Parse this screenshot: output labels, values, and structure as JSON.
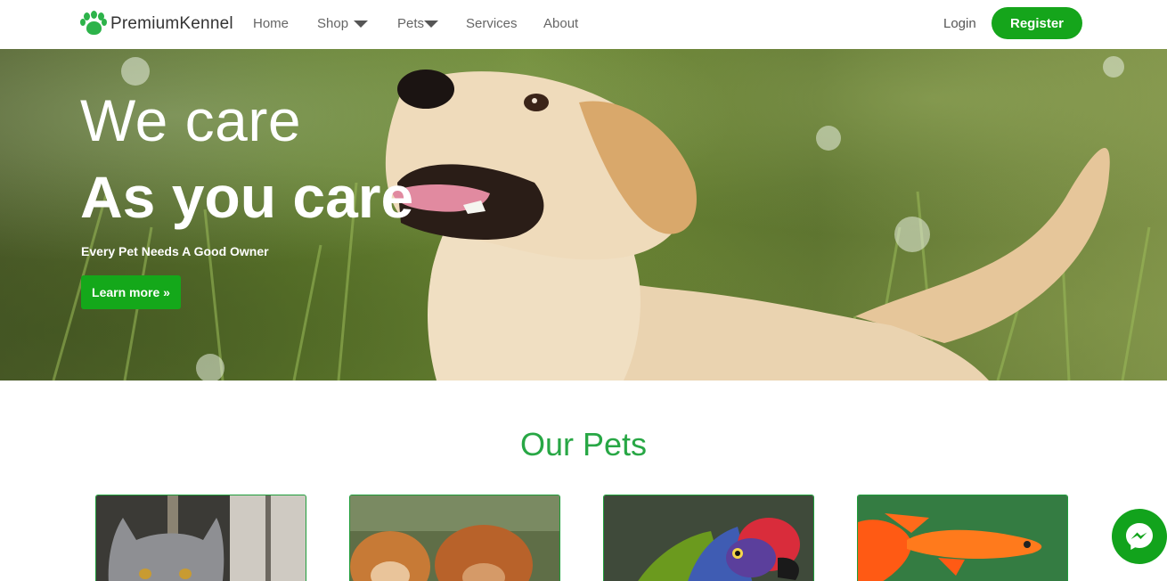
{
  "brand": {
    "name": "PremiumKennel"
  },
  "nav": {
    "items": [
      {
        "label": "Home",
        "has_dropdown": false
      },
      {
        "label": "Shop",
        "has_dropdown": true
      },
      {
        "label": "Pets",
        "has_dropdown": true
      },
      {
        "label": "Services",
        "has_dropdown": false
      },
      {
        "label": "About",
        "has_dropdown": false
      }
    ],
    "login_label": "Login",
    "register_label": "Register"
  },
  "hero": {
    "title_line1": "We care",
    "title_line2": "As you care",
    "subtitle": "Every Pet Needs A Good Owner",
    "cta_label": "Learn more »"
  },
  "pets_section": {
    "title": "Our Pets",
    "cards": [
      {
        "image": "cat-photo"
      },
      {
        "image": "dogs-photo"
      },
      {
        "image": "parrot-photo"
      },
      {
        "image": "fish-photo"
      }
    ]
  },
  "colors": {
    "accent": "#15a51b",
    "heading_green": "#28a745"
  },
  "icons": {
    "logo": "paw-icon",
    "chat": "messenger-icon"
  }
}
